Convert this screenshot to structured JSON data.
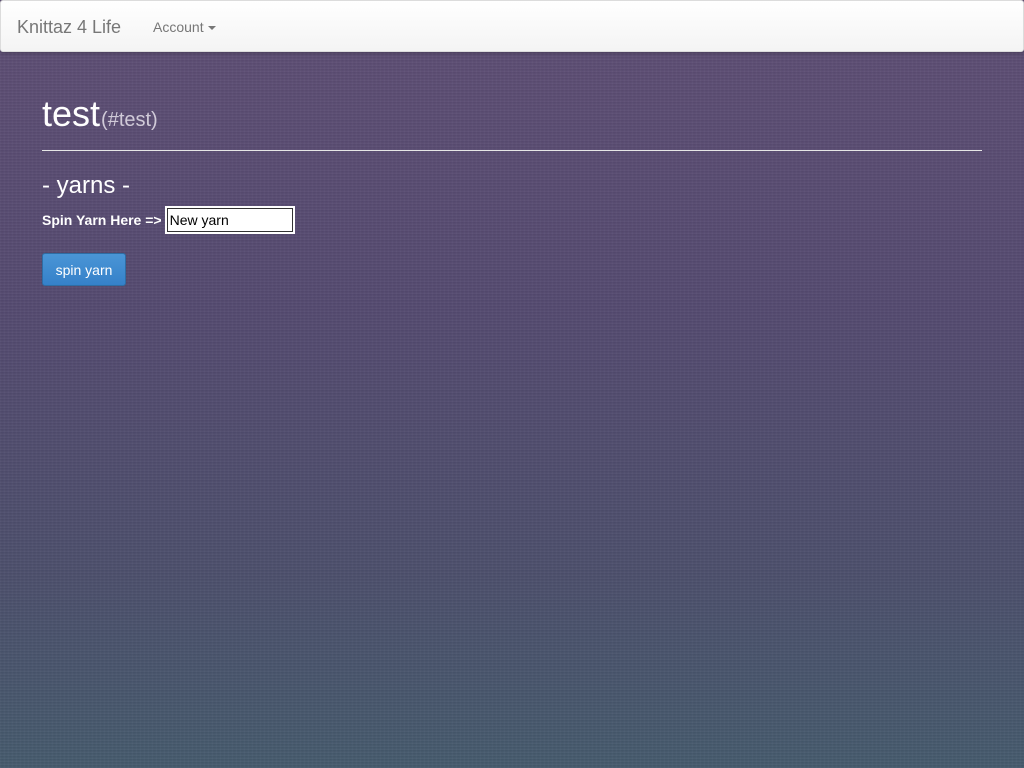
{
  "navbar": {
    "brand": "Knittaz 4 Life",
    "account_label": "Account"
  },
  "header": {
    "title": "test",
    "subtitle": "(#test)"
  },
  "section": {
    "title": "- yarns -"
  },
  "form": {
    "label": "Spin Yarn Here =>",
    "input_value": "New yarn",
    "button_label": "spin yarn"
  },
  "colors": {
    "button": "#3581c9",
    "background": "#5a4e72"
  }
}
